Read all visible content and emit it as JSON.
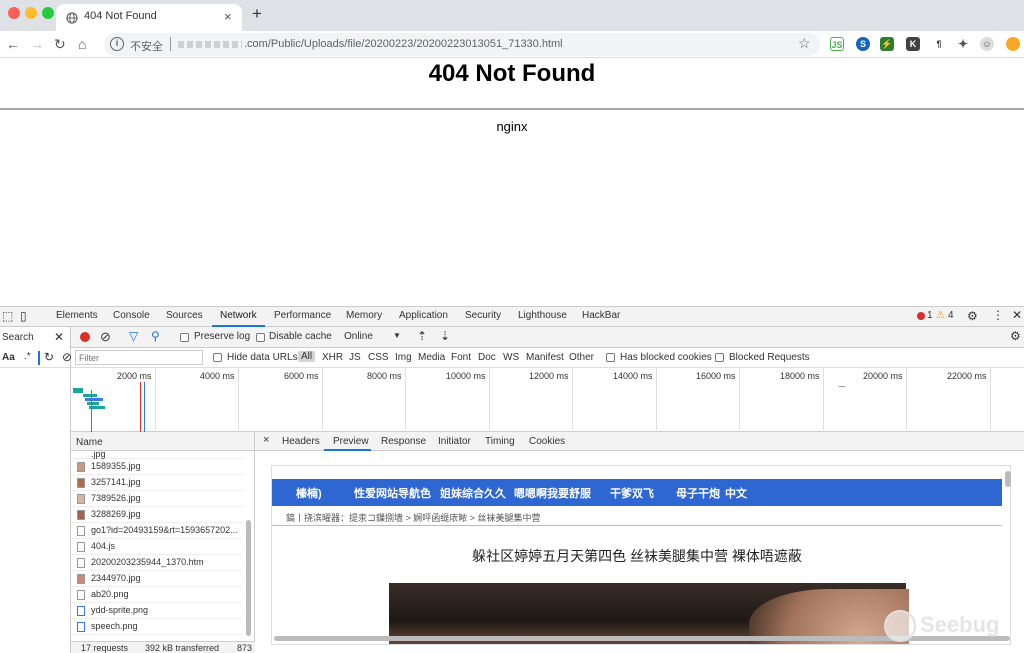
{
  "browser": {
    "tab_title": "404 Not Found",
    "tab_close": "×",
    "new_tab": "+",
    "insecure_label": "不安全",
    "url": ".com/Public/Uploads/file/20200223/20200223013051_71330.html",
    "extensions": [
      "JS",
      "S",
      "⚡",
      "K",
      "¶",
      "✦",
      "☺",
      "⬤"
    ]
  },
  "page": {
    "heading": "404 Not Found",
    "server": "nginx"
  },
  "devtools": {
    "tabs": [
      "Elements",
      "Console",
      "Sources",
      "Network",
      "Performance",
      "Memory",
      "Application",
      "Security",
      "Lighthouse",
      "HackBar"
    ],
    "active_tab": "Network",
    "errors": "1",
    "warnings": "4",
    "search_label": "Search",
    "aa_label": "Aa",
    "regex_label": ".*",
    "preserve_log": "Preserve log",
    "disable_cache": "Disable cache",
    "throttle": "Online",
    "filter_placeholder": "Filter",
    "hide_data_urls": "Hide data URLs",
    "type_filters": [
      "All",
      "XHR",
      "JS",
      "CSS",
      "Img",
      "Media",
      "Font",
      "Doc",
      "WS",
      "Manifest",
      "Other"
    ],
    "has_blocked_cookies": "Has blocked cookies",
    "blocked_requests": "Blocked Requests",
    "timeline_ticks": [
      "2000 ms",
      "4000 ms",
      "6000 ms",
      "8000 ms",
      "10000 ms",
      "12000 ms",
      "14000 ms",
      "16000 ms",
      "18000 ms",
      "20000 ms",
      "22000 ms"
    ],
    "name_header": "Name",
    "files": [
      "1589355.jpg",
      "3257141.jpg",
      "7389526.jpg",
      "3288269.jpg",
      "go1?id=20493159&rt=1593657202...",
      "404.js",
      "20200203235944_1370.htm",
      "2344970.jpg",
      "ab20.png",
      "ydd-sprite.png",
      "speech.png"
    ],
    "status": {
      "requests": "17 requests",
      "transferred": "392 kB transferred",
      "more": "873"
    },
    "detail_tabs": [
      "Headers",
      "Preview",
      "Response",
      "Initiator",
      "Timing",
      "Cookies"
    ],
    "active_detail_tab": "Preview",
    "close_x": "×"
  },
  "preview": {
    "nav": [
      "榛楠)",
      "性爱网站导航色",
      "姐妹综合久久",
      "嗯嗯啊我要舒服",
      "干爹双飞",
      "母子干炮",
      "中文"
    ],
    "breadcrumb": "鎬丨挠滨曜器：提汞コ鏁捌墙 > 娴呯函缇庡畩 > 丝袜美腿集中营",
    "headline": "躲社区婷婷五月天第四色  丝袜美腿集中营  裸体唔遮蔽"
  },
  "watermark": "Seebug"
}
